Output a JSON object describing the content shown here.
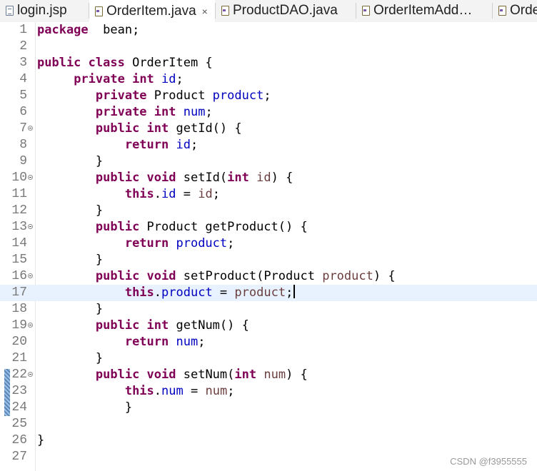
{
  "tabs": [
    {
      "label": "login.jsp",
      "icon": "jsp-file-icon",
      "active": false
    },
    {
      "label": "OrderItem.java",
      "icon": "java-file-icon",
      "active": true,
      "close": "×"
    },
    {
      "label": "ProductDAO.java",
      "icon": "java-file-icon",
      "active": false
    },
    {
      "label": "OrderItemAdd…",
      "icon": "java-file-icon",
      "active": false
    },
    {
      "label": "Orde",
      "icon": "java-file-icon",
      "active": false
    }
  ],
  "editor": {
    "current_line": 17,
    "changed_lines": [
      22,
      23,
      24
    ],
    "folding_lines": [
      7,
      10,
      13,
      16,
      19,
      22
    ],
    "lines": [
      {
        "n": "1",
        "tokens": [
          [
            "kw",
            "package"
          ],
          [
            "",
            "  bean;"
          ]
        ]
      },
      {
        "n": "2",
        "tokens": []
      },
      {
        "n": "3",
        "tokens": [
          [
            "kw",
            "public"
          ],
          [
            "",
            ""
          ],
          [
            "kw",
            " class"
          ],
          [
            "",
            " OrderItem {"
          ]
        ]
      },
      {
        "n": "4",
        "tokens": [
          [
            "",
            "     "
          ],
          [
            "kw",
            "private"
          ],
          [
            "kw",
            " int"
          ],
          [
            "fld",
            " id"
          ],
          [
            "",
            ";"
          ]
        ]
      },
      {
        "n": "5",
        "tokens": [
          [
            "",
            "        "
          ],
          [
            "kw",
            "private"
          ],
          [
            "",
            " Product "
          ],
          [
            "fld",
            "product"
          ],
          [
            "",
            ";"
          ]
        ]
      },
      {
        "n": "6",
        "tokens": [
          [
            "",
            "        "
          ],
          [
            "kw",
            "private"
          ],
          [
            "kw",
            " int"
          ],
          [
            "fld",
            " num"
          ],
          [
            "",
            ";"
          ]
        ]
      },
      {
        "n": "7",
        "tokens": [
          [
            "",
            "        "
          ],
          [
            "kw",
            "public"
          ],
          [
            "kw",
            " int"
          ],
          [
            "",
            " getId() {"
          ]
        ]
      },
      {
        "n": "8",
        "tokens": [
          [
            "",
            "            "
          ],
          [
            "kw",
            "return"
          ],
          [
            "fld",
            " id"
          ],
          [
            "",
            ";"
          ]
        ]
      },
      {
        "n": "9",
        "tokens": [
          [
            "",
            "        }"
          ]
        ]
      },
      {
        "n": "10",
        "tokens": [
          [
            "",
            "        "
          ],
          [
            "kw",
            "public"
          ],
          [
            "kw",
            " void"
          ],
          [
            "",
            " setId("
          ],
          [
            "kw",
            "int"
          ],
          [
            "prm",
            " id"
          ],
          [
            "",
            ") {"
          ]
        ]
      },
      {
        "n": "11",
        "tokens": [
          [
            "",
            "            "
          ],
          [
            "kw",
            "this"
          ],
          [
            "",
            "."
          ],
          [
            "fld",
            "id"
          ],
          [
            "",
            " = "
          ],
          [
            "prm",
            "id"
          ],
          [
            "",
            ";"
          ]
        ]
      },
      {
        "n": "12",
        "tokens": [
          [
            "",
            "        }"
          ]
        ]
      },
      {
        "n": "13",
        "tokens": [
          [
            "",
            "        "
          ],
          [
            "kw",
            "public"
          ],
          [
            "",
            " Product getProduct() {"
          ]
        ]
      },
      {
        "n": "14",
        "tokens": [
          [
            "",
            "            "
          ],
          [
            "kw",
            "return"
          ],
          [
            "fld",
            " product"
          ],
          [
            "",
            ";"
          ]
        ]
      },
      {
        "n": "15",
        "tokens": [
          [
            "",
            "        }"
          ]
        ]
      },
      {
        "n": "16",
        "tokens": [
          [
            "",
            "        "
          ],
          [
            "kw",
            "public"
          ],
          [
            "kw",
            " void"
          ],
          [
            "",
            " setProduct(Product "
          ],
          [
            "prm",
            "product"
          ],
          [
            "",
            ") {"
          ]
        ]
      },
      {
        "n": "17",
        "tokens": [
          [
            "",
            "            "
          ],
          [
            "kw",
            "this"
          ],
          [
            "",
            "."
          ],
          [
            "fld",
            "product"
          ],
          [
            "",
            " = "
          ],
          [
            "prm",
            "product"
          ],
          [
            "",
            ";"
          ]
        ]
      },
      {
        "n": "18",
        "tokens": [
          [
            "",
            "        }"
          ]
        ]
      },
      {
        "n": "19",
        "tokens": [
          [
            "",
            "        "
          ],
          [
            "kw",
            "public"
          ],
          [
            "kw",
            " int"
          ],
          [
            "",
            " getNum() {"
          ]
        ]
      },
      {
        "n": "20",
        "tokens": [
          [
            "",
            "            "
          ],
          [
            "kw",
            "return"
          ],
          [
            "fld",
            " num"
          ],
          [
            "",
            ";"
          ]
        ]
      },
      {
        "n": "21",
        "tokens": [
          [
            "",
            "        }"
          ]
        ]
      },
      {
        "n": "22",
        "tokens": [
          [
            "",
            "        "
          ],
          [
            "kw",
            "public"
          ],
          [
            "kw",
            " void"
          ],
          [
            "",
            " setNum("
          ],
          [
            "kw",
            "int"
          ],
          [
            "prm",
            " num"
          ],
          [
            "",
            ") {"
          ]
        ]
      },
      {
        "n": "23",
        "tokens": [
          [
            "",
            "            "
          ],
          [
            "kw",
            "this"
          ],
          [
            "",
            "."
          ],
          [
            "fld",
            "num"
          ],
          [
            "",
            " = "
          ],
          [
            "prm",
            "num"
          ],
          [
            "",
            ";"
          ]
        ]
      },
      {
        "n": "24",
        "tokens": [
          [
            "",
            "            }"
          ]
        ]
      },
      {
        "n": "25",
        "tokens": []
      },
      {
        "n": "26",
        "tokens": [
          [
            "",
            "}"
          ]
        ]
      },
      {
        "n": "27",
        "tokens": []
      }
    ]
  },
  "watermark": "CSDN @f3955555"
}
